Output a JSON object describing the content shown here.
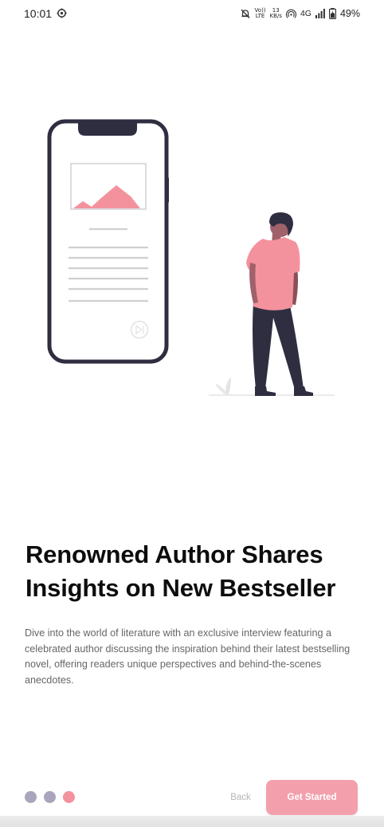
{
  "status_bar": {
    "time": "10:01",
    "lte_top": "Vo))",
    "lte_bottom": "LTE",
    "speed_top": "13",
    "speed_bottom": "KB/s",
    "network": "4G",
    "battery": "49%"
  },
  "onboarding": {
    "title": "Renowned Author Shares Insights on New Bestseller",
    "description": "Dive into the world of literature with an exclusive interview featuring a celebrated author discussing the inspiration behind their latest bestselling novel, offering readers unique perspectives and behind-the-scenes anecdotes.",
    "back_label": "Back",
    "get_started_label": "Get Started",
    "page_indicator": {
      "current": 3,
      "total": 3
    }
  },
  "colors": {
    "accent": "#f08a98",
    "accent_light": "#f3a0ac",
    "dot_inactive": "#a8a5bd",
    "phone_frame": "#2f2e41",
    "person_shirt": "#f3929d",
    "person_pants": "#2f2e41",
    "person_skin": "#a0616a",
    "text_primary": "#0d0d0d",
    "text_secondary": "#666666"
  },
  "icons": {
    "status_gear": "settings-gear-icon",
    "mute": "bell-off-icon",
    "hotspot": "hotspot-icon",
    "signal": "signal-icon",
    "battery": "battery-icon",
    "phone_play": "play-circle-icon"
  }
}
